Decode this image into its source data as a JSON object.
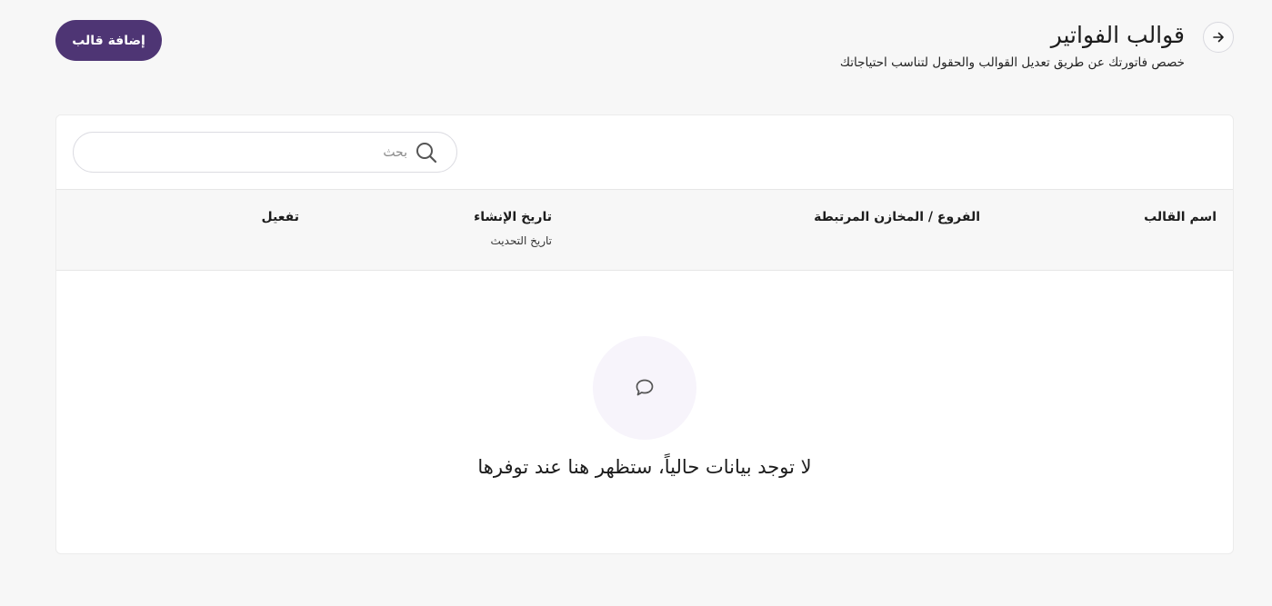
{
  "header": {
    "title": "قوالب الفواتير",
    "subtitle": "خصص فاتورتك عن طريق تعديل القوالب والحقول لتناسب احتياجاتك",
    "back_icon": "arrow-right-icon",
    "add_button_label": "إضافة قالب"
  },
  "search": {
    "placeholder": "بحث",
    "value": "",
    "icon": "search-icon"
  },
  "table": {
    "columns": [
      {
        "label": "اسم القالب",
        "sublabel": ""
      },
      {
        "label": "الفروع / المخازن المرتبطة",
        "sublabel": ""
      },
      {
        "label": "تاريخ الإنشاء",
        "sublabel": "تاريخ التحديث"
      },
      {
        "label": "تفعيل",
        "sublabel": ""
      }
    ],
    "rows": []
  },
  "empty_state": {
    "icon": "speech-bubble-icon",
    "message": "لا توجد بيانات حالياً، ستظهر هنا عند توفرها"
  },
  "colors": {
    "accent": "#4e3574",
    "background": "#f7f7f7",
    "card": "#ffffff",
    "empty_circle": "#f7f4fb"
  }
}
